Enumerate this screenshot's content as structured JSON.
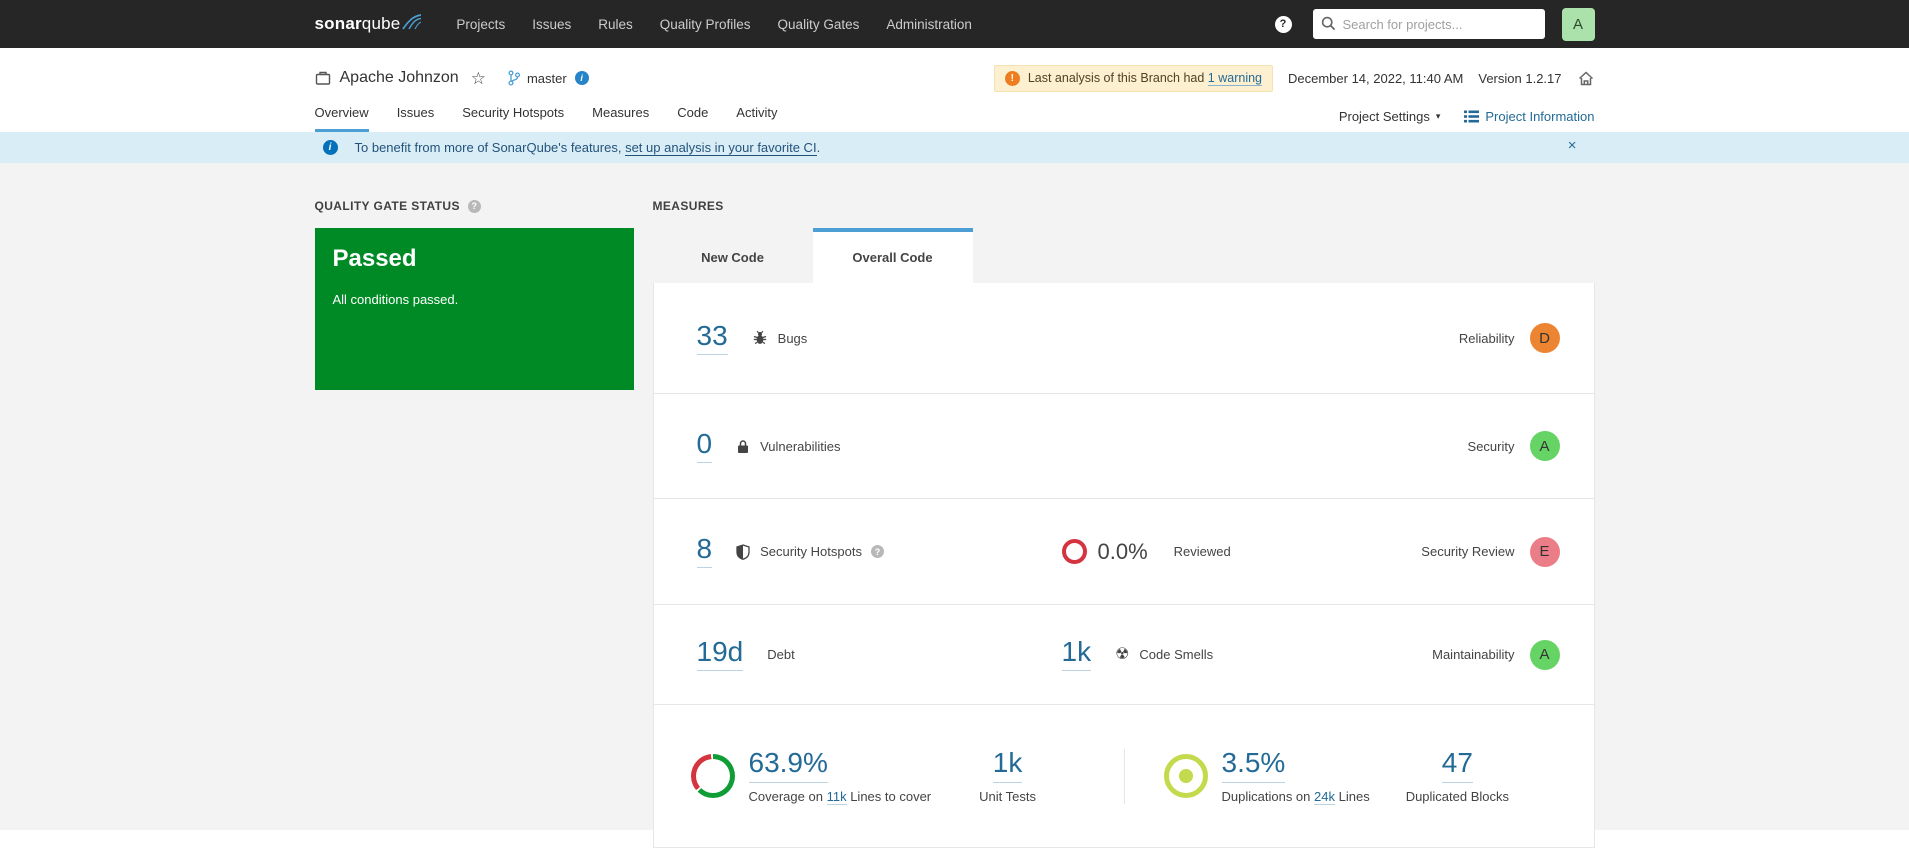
{
  "nav": {
    "logo_bold": "sonar",
    "logo_light": "qube",
    "items": [
      {
        "label": "Projects"
      },
      {
        "label": "Issues"
      },
      {
        "label": "Rules"
      },
      {
        "label": "Quality Profiles"
      },
      {
        "label": "Quality Gates"
      },
      {
        "label": "Administration"
      }
    ],
    "search": {
      "placeholder": "Search for projects..."
    },
    "avatar_letter": "A"
  },
  "header": {
    "project_name": "Apache Johnzon",
    "branch": "master",
    "warning": {
      "text": "Last analysis of this Branch had",
      "link": "1 warning"
    },
    "analysis_date": "December 14, 2022, 11:40 AM",
    "version": "Version 1.2.17",
    "tabs": [
      {
        "label": "Overview"
      },
      {
        "label": "Issues"
      },
      {
        "label": "Security Hotspots"
      },
      {
        "label": "Measures"
      },
      {
        "label": "Code"
      },
      {
        "label": "Activity"
      }
    ],
    "active_tab": "Overview",
    "project_settings_label": "Project Settings",
    "project_information_label": "Project Information"
  },
  "banner": {
    "text_before_link": "To benefit from more of SonarQube's features,",
    "link_text": "set up analysis in your favorite CI",
    "text_after_link": "."
  },
  "quality_gate": {
    "heading": "QUALITY GATE STATUS",
    "status": "Passed",
    "subtext": "All conditions passed."
  },
  "measures": {
    "heading": "MEASURES",
    "tabs": [
      {
        "label": "New Code"
      },
      {
        "label": "Overall Code"
      }
    ],
    "active_tab": "Overall Code",
    "bugs": {
      "value": "33",
      "label": "Bugs",
      "rating_label": "Reliability",
      "rating": "D",
      "rating_color": "#ed8431"
    },
    "vulnerabilities": {
      "value": "0",
      "label": "Vulnerabilities",
      "rating_label": "Security",
      "rating": "A",
      "rating_color": "#65d465"
    },
    "hotspots": {
      "value": "8",
      "label": "Security Hotspots",
      "reviewed_value": "0.0%",
      "reviewed_label": "Reviewed",
      "rating_label": "Security Review",
      "rating": "E",
      "rating_color": "#ea7d87"
    },
    "debt": {
      "value": "19d",
      "label": "Debt"
    },
    "code_smells": {
      "value": "1k",
      "label": "Code Smells",
      "rating_label": "Maintainability",
      "rating": "A",
      "rating_color": "#65d465"
    },
    "coverage": {
      "value": "63.9%",
      "percent_covered": 63.9,
      "label_before_link": "Coverage on",
      "lines_link": "11k",
      "label_after_link": "Lines to cover"
    },
    "unit_tests": {
      "value": "1k",
      "label": "Unit Tests"
    },
    "duplications": {
      "value": "3.5%",
      "label_before_link": "Duplications on",
      "lines_link": "24k",
      "label_after_link": "Lines"
    },
    "duplicated_blocks": {
      "value": "47",
      "label": "Duplicated Blocks"
    }
  },
  "colors": {
    "nav_bg": "#262626",
    "link_blue": "#236a97",
    "tab_indicator": "#4b9fd5",
    "passed_green": "#008a25",
    "banner_bg": "#d9edf7",
    "warning_bg": "#fcf0d0",
    "rating_a": "#65d465",
    "rating_d": "#ed8431",
    "rating_e": "#ea7d87",
    "coverage_green": "#0f9d35",
    "coverage_red": "#d4333f",
    "duplication_icon": "#c4d94c",
    "avatar_bg": "#abe2ab",
    "hotspot_ring_red": "#d4333f"
  }
}
